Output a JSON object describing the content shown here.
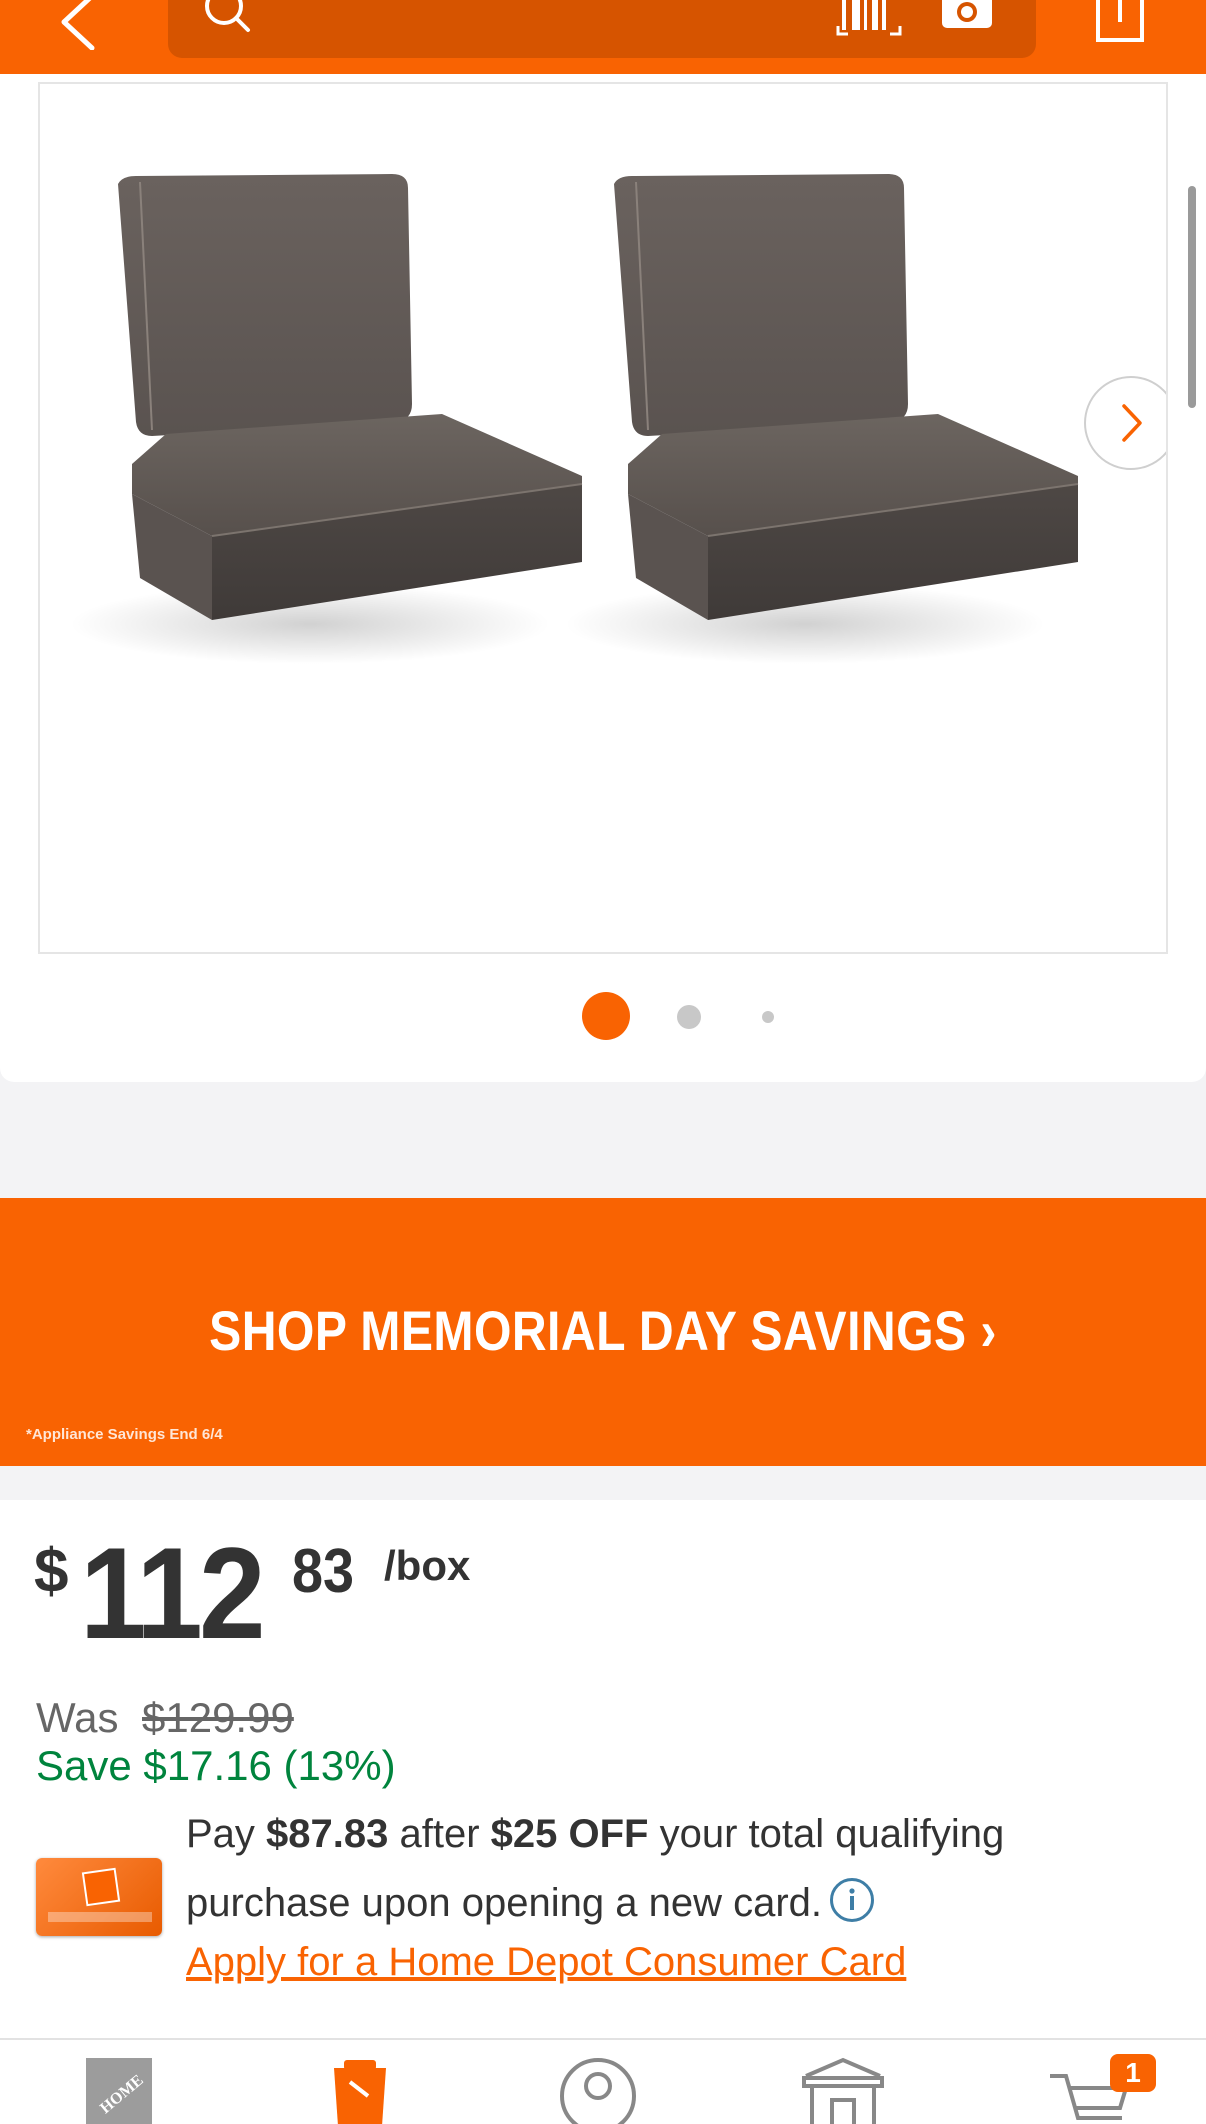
{
  "header": {
    "back_icon": "chevron-left-icon",
    "search_icon": "search-icon",
    "barcode_icon": "barcode-scanner-icon",
    "camera_icon": "camera-icon",
    "share_icon": "share-icon",
    "accent_color": "#f96302"
  },
  "gallery": {
    "current_index": 1,
    "total_images": 3,
    "next_icon": "chevron-right-icon"
  },
  "promo": {
    "title": "SHOP MEMORIAL DAY SAVINGS ›",
    "footnote": "*Appliance Savings End 6/4"
  },
  "price": {
    "dollar_sign": "$",
    "whole": "112",
    "cents": "83",
    "unit": "/box",
    "was_label": "Was",
    "was_price": "$129.99",
    "save_text": "Save $17.16 (13%)"
  },
  "card_offer": {
    "line1_pre": "Pay ",
    "line1_amount": "$87.83",
    "line1_mid": " after ",
    "line1_discount": "$25 OFF",
    "line1_post": " your total qualifying",
    "line2": "purchase upon opening a new card.",
    "apply_link": "Apply for a Home Depot Consumer Card"
  },
  "bottom_nav": {
    "items": [
      {
        "icon": "home-depot-logo-icon"
      },
      {
        "icon": "projects-icon"
      },
      {
        "icon": "account-icon"
      },
      {
        "icon": "store-icon"
      },
      {
        "icon": "cart-icon"
      }
    ],
    "cart_count": "1"
  }
}
